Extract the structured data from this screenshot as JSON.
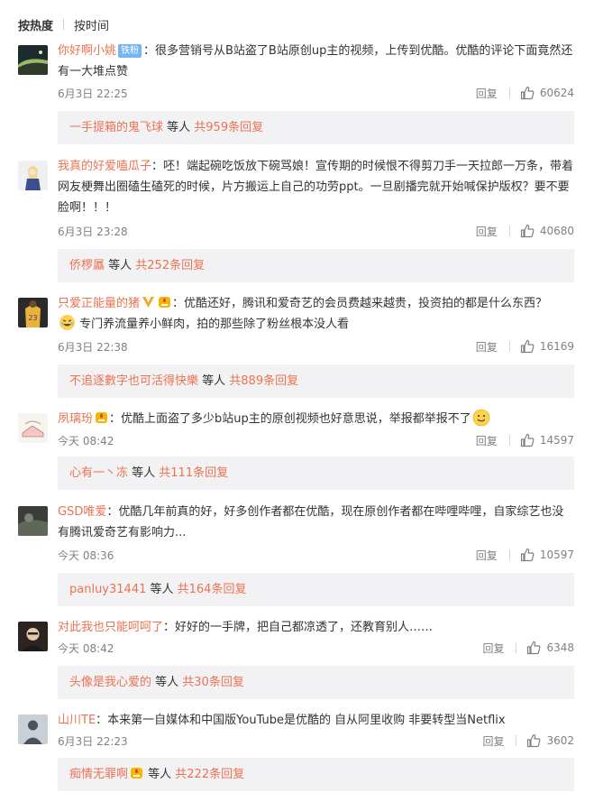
{
  "sort": {
    "hot": "按热度",
    "time": "按时间"
  },
  "comments": [
    {
      "user": "你好啊小姚",
      "tag": "铁粉",
      "text": "：很多营销号从B站盗了B站原创up主的视频，上传到优酷。优酷的评论下面竟然还有一大堆点赞",
      "time": "6月3日 22:25",
      "reply_label": "回复",
      "likes": "60624",
      "reply_summary": {
        "name": "一手提箱的鬼飞球",
        "mid": " 等人 ",
        "count": "共959条回复"
      }
    },
    {
      "user": "我真的好爱嗑瓜子",
      "text": "：呸！端起碗吃饭放下碗骂娘！宣传期的时候恨不得剪刀手一天拉郎一万条，带着网友梗舞出圈磕生磕死的时候，片方搬运上自己的功劳ppt。一旦剧播完就开始喊保护版权？要不要脸啊！！！",
      "time": "6月3日 23:28",
      "reply_label": "回复",
      "likes": "40680",
      "reply_summary": {
        "name": "侨椤屭",
        "mid": " 等人 ",
        "count": "共252条回复"
      }
    },
    {
      "user": "只爱正能量的猪",
      "text": "：优酷还好，腾讯和爱奇艺的会员费越来越贵，投资拍的都是什么东西？",
      "text2": "专门养流量养小鲜肉，拍的那些除了粉丝根本没人看",
      "time": "6月3日 22:38",
      "reply_label": "回复",
      "likes": "16169",
      "reply_summary": {
        "name": "不追逐數字也可活得快樂",
        "mid": " 等人 ",
        "count": "共889条回复"
      }
    },
    {
      "user": "夙璃玢",
      "text": "：优酷上面盗了多少b站up主的原创视频也好意思说，举报都举报不了",
      "time": "今天 08:42",
      "reply_label": "回复",
      "likes": "14597",
      "reply_summary": {
        "name": "心有一丶冻",
        "mid": " 等人 ",
        "count": "共111条回复"
      }
    },
    {
      "user": "GSD唯爱",
      "text": "：优酷几年前真的好，好多创作者都在优酷，现在原创作者都在哔哩哔哩，自家综艺也没有腾讯爱奇艺有影响力...",
      "time": "今天 08:36",
      "reply_label": "回复",
      "likes": "10597",
      "reply_summary": {
        "name": "panluy31441",
        "mid": " 等人 ",
        "count": "共164条回复"
      }
    },
    {
      "user": "对此我也只能呵呵了",
      "text": "：好好的一手牌，把自己都凉透了，还教育别人……",
      "time": "今天 08:42",
      "reply_label": "回复",
      "likes": "6348",
      "reply_summary": {
        "name": "头像是我心爱的",
        "mid": " 等人 ",
        "count": "共30条回复"
      }
    },
    {
      "user": "山川TE",
      "text": "：本来第一自媒体和中国版YouTube是优酷的 自从阿里收购 非要转型当Netflix",
      "time": "6月3日 22:23",
      "reply_label": "回复",
      "likes": "3602",
      "reply_summary": {
        "name": "痴情无罪啊",
        "mid": " 等人 ",
        "count": "共222条回复"
      }
    }
  ]
}
